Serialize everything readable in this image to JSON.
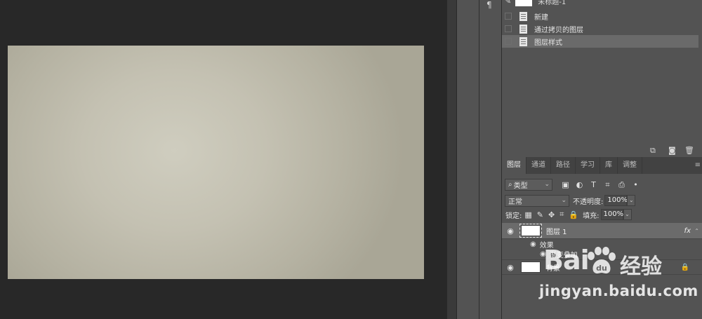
{
  "history": {
    "snapshot_label": "未标题-1",
    "items": [
      {
        "label": "新建",
        "selected": false
      },
      {
        "label": "通过拷贝的图层",
        "selected": false
      },
      {
        "label": "图层样式",
        "selected": true
      }
    ],
    "footer_icons": [
      "new-document-from-state-icon",
      "camera-icon",
      "trash-icon"
    ]
  },
  "layers_panel": {
    "tabs": [
      {
        "label": "图层",
        "active": true
      },
      {
        "label": "通道",
        "active": false
      },
      {
        "label": "路径",
        "active": false
      },
      {
        "label": "学习",
        "active": false
      },
      {
        "label": "库",
        "active": false
      },
      {
        "label": "调整",
        "active": false
      }
    ],
    "filter": {
      "kind_label": "类型"
    },
    "blend_mode": "正常",
    "opacity_label": "不透明度:",
    "opacity_value": "100%",
    "lock_label": "锁定:",
    "fill_label": "填充:",
    "fill_value": "100%",
    "layers": [
      {
        "name": "图层 1",
        "selected": true,
        "fx": "fx"
      },
      {
        "name": "背景",
        "selected": false,
        "locked": true
      }
    ],
    "effects_label": "效果",
    "effects": [
      "渐变叠加"
    ]
  },
  "watermark": {
    "logo_left": "Bai",
    "logo_right": "经验",
    "url": "jingyan.baidu.com"
  }
}
